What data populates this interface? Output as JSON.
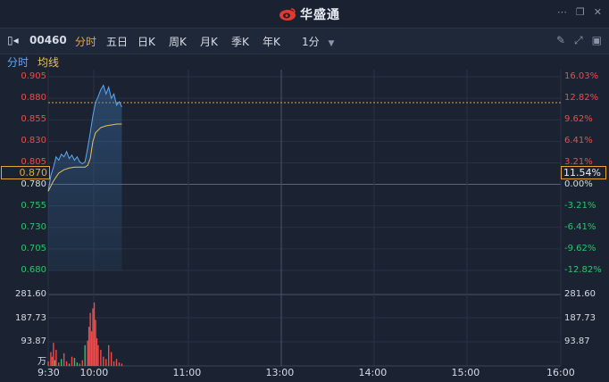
{
  "app": {
    "name": "华盛通",
    "logo_icon": "weibo-eye-logo"
  },
  "window": {
    "icons": [
      "more-icon",
      "restore-icon",
      "close-icon"
    ]
  },
  "toolbar": {
    "stock_code": "00460",
    "tabs": [
      {
        "label": "分时",
        "active": true
      },
      {
        "label": "五日",
        "active": false
      },
      {
        "label": "日K",
        "active": false
      },
      {
        "label": "周K",
        "active": false
      },
      {
        "label": "月K",
        "active": false
      },
      {
        "label": "季K",
        "active": false
      },
      {
        "label": "年K",
        "active": false
      }
    ],
    "interval": "1分",
    "icons": [
      "draw-icon",
      "expand-icon",
      "window-icon"
    ]
  },
  "legend": {
    "timeshare": "分时",
    "average": "均线"
  },
  "colors": {
    "up": "#f04a4a",
    "down": "#2fc26b",
    "price_line": "#5fa8ef",
    "avg_line": "#e8c35a",
    "accent": "#e8a536"
  },
  "price_axis": {
    "left": [
      "0.905",
      "0.880",
      "0.855",
      "0.830",
      "0.805",
      "0.780",
      "0.755",
      "0.730",
      "0.705",
      "0.680"
    ],
    "right": [
      "16.03%",
      "12.82%",
      "9.62%",
      "6.41%",
      "3.21%",
      "0.00%",
      "-3.21%",
      "-6.41%",
      "-9.62%",
      "-12.82%"
    ],
    "current_price": "0.870",
    "current_pct": "11.54%"
  },
  "volume_axis": {
    "labels": [
      "281.60",
      "187.73",
      "93.87"
    ],
    "unit": "万"
  },
  "time_axis": [
    "9:30",
    "10:00",
    "11:00",
    "13:00",
    "14:00",
    "15:00",
    "16:00"
  ],
  "chart_data": {
    "type": "line",
    "prev_close": 0.78,
    "price_series": {
      "name": "分时",
      "x": [
        0,
        2,
        4,
        6,
        8,
        10,
        12,
        14,
        16,
        18,
        20,
        22,
        24,
        26,
        28,
        30,
        32,
        34,
        36,
        38,
        40,
        42,
        44,
        46,
        48,
        50,
        52,
        54,
        56
      ],
      "values": [
        0.772,
        0.79,
        0.8,
        0.812,
        0.808,
        0.815,
        0.812,
        0.818,
        0.81,
        0.814,
        0.808,
        0.812,
        0.806,
        0.804,
        0.806,
        0.822,
        0.84,
        0.86,
        0.875,
        0.882,
        0.89,
        0.895,
        0.885,
        0.893,
        0.88,
        0.885,
        0.872,
        0.876,
        0.87
      ]
    },
    "avg_series": {
      "name": "均线",
      "x": [
        0,
        4,
        8,
        12,
        16,
        20,
        24,
        28,
        30,
        32,
        34,
        36,
        38,
        40,
        44,
        48,
        52,
        56
      ],
      "values": [
        0.772,
        0.784,
        0.793,
        0.797,
        0.799,
        0.8,
        0.8,
        0.8,
        0.802,
        0.81,
        0.83,
        0.84,
        0.843,
        0.846,
        0.848,
        0.849,
        0.85,
        0.85
      ]
    },
    "volume": {
      "x": [
        0,
        2,
        3,
        4,
        5,
        6,
        8,
        10,
        12,
        14,
        16,
        18,
        20,
        22,
        24,
        26,
        28,
        30,
        31,
        32,
        33,
        34,
        35,
        36,
        37,
        38,
        40,
        42,
        44,
        46,
        48,
        50,
        52,
        54,
        56
      ],
      "values": [
        20,
        60,
        40,
        100,
        25,
        70,
        15,
        30,
        55,
        20,
        10,
        40,
        35,
        15,
        10,
        25,
        90,
        110,
        170,
        230,
        150,
        250,
        275,
        200,
        120,
        90,
        70,
        40,
        30,
        90,
        60,
        20,
        30,
        15,
        10
      ],
      "up": [
        1,
        1,
        1,
        1,
        0,
        1,
        1,
        0,
        1,
        1,
        0,
        1,
        0,
        0,
        1,
        1,
        0,
        1,
        1,
        1,
        1,
        1,
        1,
        1,
        1,
        1,
        1,
        1,
        1,
        1,
        1,
        1,
        1,
        1,
        1
      ]
    }
  }
}
